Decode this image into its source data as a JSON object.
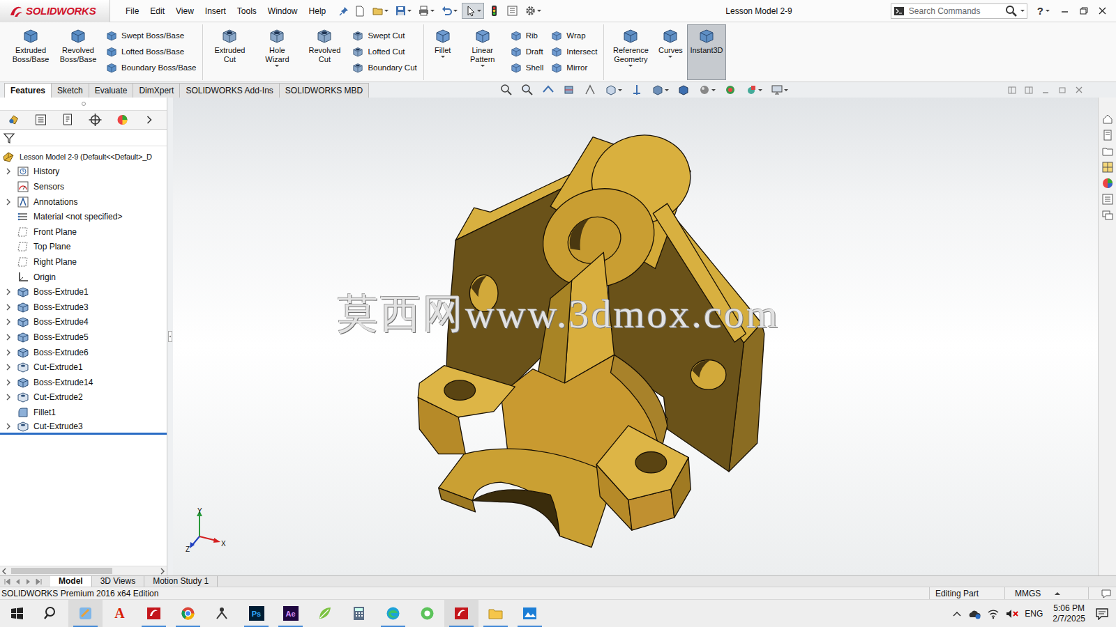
{
  "app": {
    "logo": "SOLIDWORKS",
    "title": "Lesson Model 2-9"
  },
  "menu": [
    "File",
    "Edit",
    "View",
    "Insert",
    "Tools",
    "Window",
    "Help"
  ],
  "search": {
    "placeholder": "Search Commands"
  },
  "help": "?",
  "ribbon": {
    "groups": [
      {
        "columns": [
          {
            "kind": "large",
            "label": "Extruded Boss/Base",
            "selected": false,
            "dropdown": false
          },
          {
            "kind": "large",
            "label": "Revolved Boss/Base",
            "selected": false,
            "dropdown": false
          },
          {
            "kind": "stack",
            "items": [
              {
                "label": "Swept Boss/Base"
              },
              {
                "label": "Lofted Boss/Base"
              },
              {
                "label": "Boundary Boss/Base"
              }
            ]
          }
        ]
      },
      {
        "columns": [
          {
            "kind": "large",
            "label": "Extruded Cut",
            "selected": false,
            "dropdown": false
          },
          {
            "kind": "large",
            "label": "Hole Wizard",
            "selected": false,
            "dropdown": true
          },
          {
            "kind": "large",
            "label": "Revolved Cut",
            "selected": false,
            "dropdown": false
          },
          {
            "kind": "stack",
            "items": [
              {
                "label": "Swept Cut"
              },
              {
                "label": "Lofted Cut"
              },
              {
                "label": "Boundary Cut"
              }
            ]
          }
        ]
      },
      {
        "columns": [
          {
            "kind": "large",
            "label": "Fillet",
            "selected": false,
            "dropdown": true
          },
          {
            "kind": "large",
            "label": "Linear Pattern",
            "selected": false,
            "dropdown": true
          },
          {
            "kind": "stack",
            "items": [
              {
                "label": "Rib"
              },
              {
                "label": "Draft"
              },
              {
                "label": "Shell"
              }
            ]
          },
          {
            "kind": "stack",
            "items": [
              {
                "label": "Wrap"
              },
              {
                "label": "Intersect"
              },
              {
                "label": "Mirror"
              }
            ]
          }
        ]
      },
      {
        "columns": [
          {
            "kind": "large",
            "label": "Reference Geometry",
            "selected": false,
            "dropdown": true
          },
          {
            "kind": "large",
            "label": "Curves",
            "selected": false,
            "dropdown": true
          },
          {
            "kind": "large",
            "label": "Instant3D",
            "selected": true,
            "dropdown": false
          }
        ]
      }
    ]
  },
  "command_tabs": [
    {
      "label": "Features",
      "selected": true
    },
    {
      "label": "Sketch",
      "selected": false
    },
    {
      "label": "Evaluate",
      "selected": false
    },
    {
      "label": "DimXpert",
      "selected": false
    },
    {
      "label": "SOLIDWORKS Add-Ins",
      "selected": false
    },
    {
      "label": "SOLIDWORKS MBD",
      "selected": false
    }
  ],
  "feature_tree": {
    "root": "Lesson Model 2-9 (Default<<Default>_D",
    "items": [
      {
        "label": "History",
        "kind": "history",
        "expandable": true,
        "rollback": false
      },
      {
        "label": "Sensors",
        "kind": "sensor",
        "expandable": false,
        "rollback": false
      },
      {
        "label": "Annotations",
        "kind": "annotation",
        "expandable": true,
        "rollback": false
      },
      {
        "label": "Material <not specified>",
        "kind": "material",
        "expandable": false,
        "rollback": false
      },
      {
        "label": "Front Plane",
        "kind": "plane",
        "expandable": false,
        "rollback": false
      },
      {
        "label": "Top Plane",
        "kind": "plane",
        "expandable": false,
        "rollback": false
      },
      {
        "label": "Right Plane",
        "kind": "plane",
        "expandable": false,
        "rollback": false
      },
      {
        "label": "Origin",
        "kind": "origin",
        "expandable": false,
        "rollback": false
      },
      {
        "label": "Boss-Extrude1",
        "kind": "boss",
        "expandable": true,
        "rollback": false
      },
      {
        "label": "Boss-Extrude3",
        "kind": "boss",
        "expandable": true,
        "rollback": false
      },
      {
        "label": "Boss-Extrude4",
        "kind": "boss",
        "expandable": true,
        "rollback": false
      },
      {
        "label": "Boss-Extrude5",
        "kind": "boss",
        "expandable": true,
        "rollback": false
      },
      {
        "label": "Boss-Extrude6",
        "kind": "boss",
        "expandable": true,
        "rollback": false
      },
      {
        "label": "Cut-Extrude1",
        "kind": "cut",
        "expandable": true,
        "rollback": false
      },
      {
        "label": "Boss-Extrude14",
        "kind": "boss",
        "expandable": true,
        "rollback": false
      },
      {
        "label": "Cut-Extrude2",
        "kind": "cut",
        "expandable": true,
        "rollback": false
      },
      {
        "label": "Fillet1",
        "kind": "fillet",
        "expandable": false,
        "rollback": false
      },
      {
        "label": "Cut-Extrude3",
        "kind": "cut",
        "expandable": true,
        "rollback": true
      }
    ]
  },
  "viewport": {
    "watermark": "莫西网www.3dmox.com",
    "triad": {
      "y": "Y",
      "z": "Z",
      "x": "X"
    }
  },
  "view_tabs": [
    {
      "label": "Model",
      "selected": true
    },
    {
      "label": "3D Views",
      "selected": false
    },
    {
      "label": "Motion Study 1",
      "selected": false
    }
  ],
  "status_bar": {
    "edition": "SOLIDWORKS Premium 2016 x64 Edition",
    "mode": "Editing Part",
    "units": "MMGS"
  },
  "taskbar": {
    "apps": [
      {
        "kind": "windows",
        "running": false,
        "active": false
      },
      {
        "kind": "search",
        "running": false,
        "active": false
      },
      {
        "kind": "paint",
        "running": true,
        "active": true
      },
      {
        "kind": "acrobat",
        "label": "A",
        "running": false,
        "active": false
      },
      {
        "kind": "solidworks",
        "running": true,
        "active": false
      },
      {
        "kind": "chrome",
        "running": true,
        "active": false
      },
      {
        "kind": "people",
        "running": false,
        "active": false
      },
      {
        "kind": "photoshop",
        "label": "Ps",
        "running": true,
        "active": false
      },
      {
        "kind": "aftereffects",
        "label": "Ae",
        "running": true,
        "active": false
      },
      {
        "kind": "leaf",
        "running": false,
        "active": false
      },
      {
        "kind": "calculator",
        "running": false,
        "active": false
      },
      {
        "kind": "edge",
        "running": true,
        "active": false
      },
      {
        "kind": "green",
        "running": false,
        "active": false
      },
      {
        "kind": "solidworks",
        "running": true,
        "active": true
      },
      {
        "kind": "explorer",
        "running": true,
        "active": false
      },
      {
        "kind": "photos",
        "running": true,
        "active": false
      }
    ],
    "language": "ENG",
    "time": "5:06 PM",
    "date": "2/7/2025"
  }
}
